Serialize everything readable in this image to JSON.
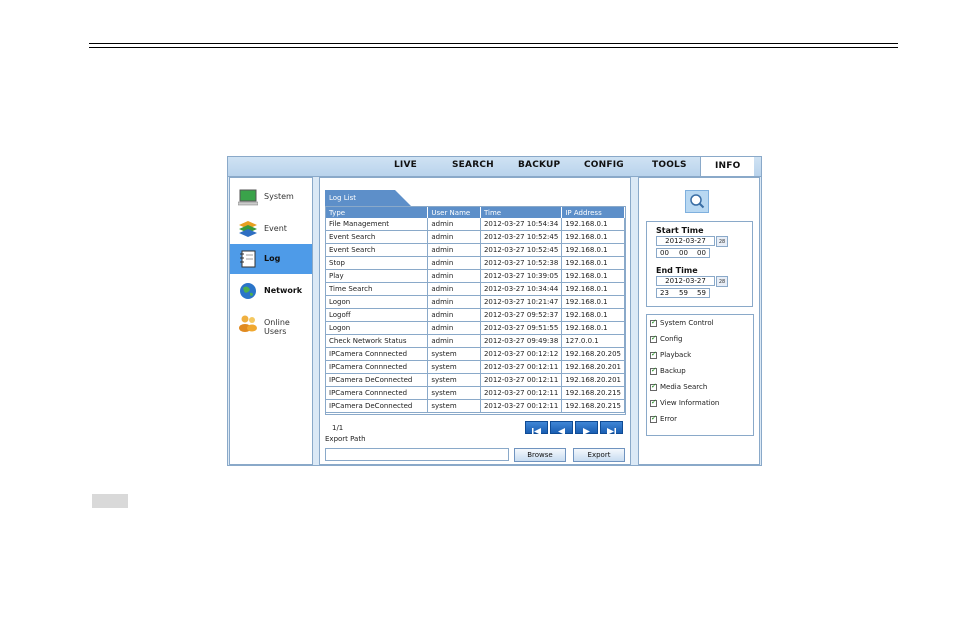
{
  "nav": {
    "items": [
      "LIVE",
      "SEARCH",
      "BACKUP",
      "CONFIG",
      "TOOLS",
      "INFO"
    ],
    "active": "INFO"
  },
  "sidebar": {
    "items": [
      {
        "label": "System",
        "icon": "monitor-icon"
      },
      {
        "label": "Event",
        "icon": "layers-icon"
      },
      {
        "label": "Log",
        "icon": "notebook-icon",
        "active": true
      },
      {
        "label": "Network",
        "icon": "globe-icon"
      },
      {
        "label": "Online Users",
        "icon": "users-icon"
      }
    ]
  },
  "log": {
    "tab_label": "Log List",
    "columns": [
      "Type",
      "User Name",
      "Time",
      "IP Address"
    ],
    "rows": [
      [
        "File Management",
        "admin",
        "2012-03-27 10:54:34",
        "192.168.0.1"
      ],
      [
        "Event Search",
        "admin",
        "2012-03-27 10:52:45",
        "192.168.0.1"
      ],
      [
        "Event Search",
        "admin",
        "2012-03-27 10:52:45",
        "192.168.0.1"
      ],
      [
        "Stop",
        "admin",
        "2012-03-27 10:52:38",
        "192.168.0.1"
      ],
      [
        "Play",
        "admin",
        "2012-03-27 10:39:05",
        "192.168.0.1"
      ],
      [
        "Time Search",
        "admin",
        "2012-03-27 10:34:44",
        "192.168.0.1"
      ],
      [
        "Logon",
        "admin",
        "2012-03-27 10:21:47",
        "192.168.0.1"
      ],
      [
        "Logoff",
        "admin",
        "2012-03-27 09:52:37",
        "192.168.0.1"
      ],
      [
        "Logon",
        "admin",
        "2012-03-27 09:51:55",
        "192.168.0.1"
      ],
      [
        "Check Network Status",
        "admin",
        "2012-03-27 09:49:38",
        "127.0.0.1"
      ],
      [
        "IPCamera Connnected",
        "system",
        "2012-03-27 00:12:12",
        "192.168.20.205"
      ],
      [
        "IPCamera Connnected",
        "system",
        "2012-03-27 00:12:11",
        "192.168.20.201"
      ],
      [
        "IPCamera DeConnected",
        "system",
        "2012-03-27 00:12:11",
        "192.168.20.201"
      ],
      [
        "IPCamera Connnected",
        "system",
        "2012-03-27 00:12:11",
        "192.168.20.215"
      ],
      [
        "IPCamera DeConnected",
        "system",
        "2012-03-27 00:12:11",
        "192.168.20.215"
      ]
    ],
    "page_info": "1/1",
    "export_label": "Export Path",
    "export_path_value": "",
    "browse_label": "Browse",
    "export_label_btn": "Export"
  },
  "filters": {
    "start_title": "Start Time",
    "start_date": "2012-03-27",
    "start_time": [
      "00",
      "00",
      "00"
    ],
    "end_title": "End Time",
    "end_date": "2012-03-27",
    "end_time": [
      "23",
      "59",
      "59"
    ],
    "calendar_label": "28",
    "checkboxes": [
      {
        "label": "System Control",
        "checked": true
      },
      {
        "label": "Config",
        "checked": true
      },
      {
        "label": "Playback",
        "checked": true
      },
      {
        "label": "Backup",
        "checked": true
      },
      {
        "label": "Media Search",
        "checked": true
      },
      {
        "label": "View Information",
        "checked": true
      },
      {
        "label": "Error",
        "checked": true
      }
    ]
  },
  "colors": {
    "accent": "#4e9be8",
    "header_bg": "#5d8fc9",
    "frame_bg": "#dbe9f6",
    "border": "#8aa9c9"
  }
}
